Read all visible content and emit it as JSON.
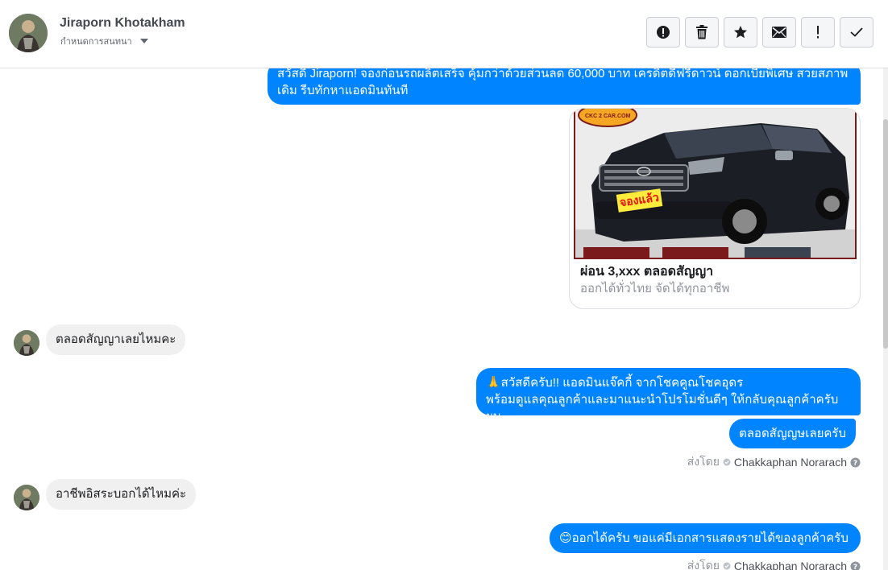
{
  "header": {
    "name": "Jiraporn Khotakham",
    "sub_label": "กำหนดการสนทนา",
    "actions": [
      {
        "icon": "alert-circle-icon",
        "label": "spam"
      },
      {
        "icon": "trash-icon",
        "label": "delete"
      },
      {
        "icon": "star-icon",
        "label": "star"
      },
      {
        "icon": "envelope-icon",
        "label": "mark-unread"
      },
      {
        "icon": "exclamation-icon",
        "label": "follow-up"
      },
      {
        "icon": "check-icon",
        "label": "done"
      }
    ]
  },
  "thread": {
    "msg_top": "สวัสดี Jiraporn! จองก่อนรถผลิตเสร็จ คุ้มกว่าด้วยส่วนลด 60,000 บาท เครดิตดีฟรีดาวน์ ดอกเบี้ยพิเศษ สวยสภาพเดิม รีบทักหาแอดมินทันที",
    "card": {
      "watermark": "CKC 2 CAR.COM",
      "badge": "จองแล้ว",
      "title": "ผ่อน 3,xxx ตลอดสัญญา",
      "subtitle": "ออกได้ทั่วไทย จัดได้ทุกอาชีพ"
    },
    "msg_in_1": "ตลอดสัญญาเลยไหมคะ",
    "msg_out_2a": "🙏สวัสดีครับ!! แอดมินแจ๊คกี้ จากโชคคูณโชคอุดร",
    "msg_out_2b": "พร้อมดูแลคุณลูกค้าและมาแนะนำโปรโมชั่นดีๆ ให้กลับคุณลูกค้าครับผม",
    "msg_out_3": "ตลอดสัญญษเลยครับ",
    "sent_by_label": "ส่งโดย",
    "agent_name": "Chakkaphan Norarach",
    "msg_in_2": "อาชีพอิสระบอกได้ไหมค่ะ",
    "msg_out_4": "😊ออกได้ครับ ขอแค่มีเอกสารแสดงรายได้ของลูกค้าครับ",
    "accent_color": "#0084ff"
  }
}
